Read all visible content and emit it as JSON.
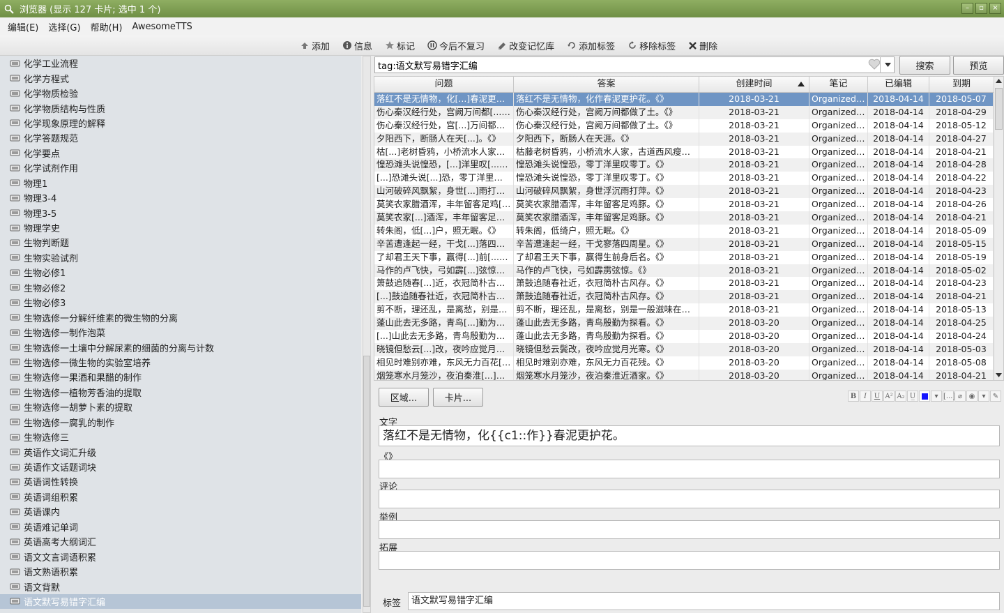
{
  "window": {
    "title": "浏览器 (显示 127 卡片; 选中 1 个)",
    "btn_min": "–",
    "btn_restore": "▫",
    "btn_close": "×"
  },
  "menu": [
    "编辑(E)",
    "选择(G)",
    "帮助(H)",
    "AwesomeTTS"
  ],
  "toolbar": {
    "add": "添加",
    "info": "信息",
    "mark": "标记",
    "suspend": "今后不复习",
    "change_deck": "改变记忆库",
    "add_tags": "添加标签",
    "remove_tags": "移除标签",
    "delete": "删除"
  },
  "decks": [
    "化学工业流程",
    "化学方程式",
    "化学物质检验",
    "化学物质结构与性质",
    "化学现象原理的解释",
    "化学答题规范",
    "化学要点",
    "化学试剂作用",
    "物理1",
    "物理3-4",
    "物理3-5",
    "物理学史",
    "生物判断题",
    "生物实验试剂",
    "生物必修1",
    "生物必修2",
    "生物必修3",
    "生物选修一分解纤维素的微生物的分离",
    "生物选修一制作泡菜",
    "生物选修一土壤中分解尿素的细菌的分离与计数",
    "生物选修一微生物的实验室培养",
    "生物选修一果酒和果醋的制作",
    "生物选修一植物芳香油的提取",
    "生物选修一胡萝卜素的提取",
    "生物选修一腐乳的制作",
    "生物选修三",
    "英语作文词汇升级",
    "英语作文话题词块",
    "英语词性转换",
    "英语词组积累",
    "英语课内",
    "英语难记单词",
    "英语高考大纲词汇",
    "语文文言词语积累",
    "语文熟语积累",
    "语文背默",
    "语文默写易错字汇编"
  ],
  "selected_deck_index": 36,
  "search": {
    "value": "tag:语文默写易错字汇编"
  },
  "buttons": {
    "search": "搜索",
    "preview": "预览",
    "fields": "区域...",
    "cards": "卡片..."
  },
  "columns": [
    "问题",
    "答案",
    "创建时间",
    "笔记",
    "已编辑",
    "到期"
  ],
  "rows": [
    [
      "落红不是无情物，化[...]春泥更护花。《》",
      "落红不是无情物，化作春泥更护花。《》",
      "2018-03-21",
      "Organized ...",
      "2018-04-14",
      "2018-05-07"
    ],
    [
      "伤心秦汉经行处，宫阙万间都[...]了土。《》",
      "伤心秦汉经行处，宫阙万间都做了土。《》",
      "2018-03-21",
      "Organized ...",
      "2018-04-14",
      "2018-04-29"
    ],
    [
      "伤心秦汉经行处，宫[...]万间都做了土。《》",
      "伤心秦汉经行处，宫阙万间都做了土。《》",
      "2018-03-21",
      "Organized ...",
      "2018-04-14",
      "2018-05-12"
    ],
    [
      "夕阳西下，断肠人在天[...]。《》",
      "夕阳西下，断肠人在天涯。《》",
      "2018-03-21",
      "Organized ...",
      "2018-04-14",
      "2018-04-27"
    ],
    [
      "枯[...]老树昏鸦，小桥流水人家，古道西风瘦马。《》",
      "枯藤老树昏鸦，小桥流水人家，古道西风瘦马。《》",
      "2018-03-21",
      "Organized ...",
      "2018-04-14",
      "2018-04-21"
    ],
    [
      "惶恐滩头说惶恐，[...]洋里叹[...]。《》",
      "惶恐滩头说惶恐，零丁洋里叹零丁。《》",
      "2018-03-21",
      "Organized ...",
      "2018-04-14",
      "2018-04-28"
    ],
    [
      "[...]恐滩头说[...]恐，零丁洋里叹零丁。《》",
      "惶恐滩头说惶恐，零丁洋里叹零丁。《》",
      "2018-03-21",
      "Organized ...",
      "2018-04-14",
      "2018-04-22"
    ],
    [
      "山河破碎风飘絮，身世[...]雨打萍。《》",
      "山河破碎风飘絮，身世浮沉雨打萍。《》",
      "2018-03-21",
      "Organized ...",
      "2018-04-14",
      "2018-04-23"
    ],
    [
      "莫笑农家腊酒浑，丰年留客足鸡[...]。《》",
      "莫笑农家腊酒浑，丰年留客足鸡豚。《》",
      "2018-03-21",
      "Organized ...",
      "2018-04-14",
      "2018-04-26"
    ],
    [
      "莫笑农家[...]酒浑，丰年留客足鸡豚。《》",
      "莫笑农家腊酒浑，丰年留客足鸡豚。《》",
      "2018-03-21",
      "Organized ...",
      "2018-04-14",
      "2018-04-21"
    ],
    [
      "转朱阁，低[...]户，照无眠。《》",
      "转朱阁，低绮户，照无眠。《》",
      "2018-03-21",
      "Organized ...",
      "2018-04-14",
      "2018-05-09"
    ],
    [
      "辛苦遭逢起一经，干戈[...]落四周星。《》",
      "辛苦遭逢起一经，干戈寥落四周星。《》",
      "2018-03-21",
      "Organized ...",
      "2018-04-14",
      "2018-05-15"
    ],
    [
      "了却君王天下事，赢得[...]前[...]后名。《》",
      "了却君王天下事，赢得生前身后名。《》",
      "2018-03-21",
      "Organized ...",
      "2018-04-14",
      "2018-05-19"
    ],
    [
      "马作的卢飞快，弓如霹[...]弦惊。《》",
      "马作的卢飞快，弓如霹雳弦惊。《》",
      "2018-03-21",
      "Organized ...",
      "2018-04-14",
      "2018-05-02"
    ],
    [
      "箫鼓追随春[...]近，衣冠简朴古风存。《》",
      "箫鼓追随春社近，衣冠简朴古风存。《》",
      "2018-03-21",
      "Organized ...",
      "2018-04-14",
      "2018-04-23"
    ],
    [
      "[...]鼓追随春社近，衣冠简朴古风存。《》",
      "箫鼓追随春社近，衣冠简朴古风存。《》",
      "2018-03-21",
      "Organized ...",
      "2018-04-14",
      "2018-04-21"
    ],
    [
      "剪不断，理还乱，是离愁，别是一[...]滋味在心头。《》",
      "剪不断，理还乱，是离愁，别是一般滋味在心头。《》",
      "2018-03-21",
      "Organized ...",
      "2018-04-14",
      "2018-05-13"
    ],
    [
      "蓬山此去无多路，青鸟[...]勤为探看。《》",
      "蓬山此去无多路，青鸟殷勤为探看。《》",
      "2018-03-20",
      "Organized ...",
      "2018-04-14",
      "2018-04-25"
    ],
    [
      "[...]山此去无多路，青鸟殷勤为探看。《》",
      "蓬山此去无多路，青鸟殷勤为探看。《》",
      "2018-03-20",
      "Organized ...",
      "2018-04-14",
      "2018-04-24"
    ],
    [
      "晓镜但愁云[...]改，夜吟应觉月光寒。《》",
      "晓镜但愁云鬓改，夜吟应觉月光寒。《》",
      "2018-03-20",
      "Organized ...",
      "2018-04-14",
      "2018-05-03"
    ],
    [
      "相见时难别亦难，东风无力百花[...]。《》",
      "相见时难别亦难，东风无力百花残。《》",
      "2018-03-20",
      "Organized ...",
      "2018-04-14",
      "2018-05-08"
    ],
    [
      "烟笼寒水月笼沙，夜泊秦淮[...]酒家。《》",
      "烟笼寒水月笼沙，夜泊秦淮近酒家。《》",
      "2018-03-20",
      "Organized ...",
      "2018-04-14",
      "2018-04-21"
    ]
  ],
  "editor": {
    "field_labels": [
      "文字",
      "《》",
      "评论",
      "举例",
      "拓展"
    ],
    "text_value": "落红不是无情物，化{{c1::作}}春泥更护花。",
    "tags_label": "标签",
    "tags_value": "语文默写易错字汇编"
  },
  "colors": {
    "titlebar": "#7f9e52",
    "selection": "#6f95c4",
    "sidebar": "#dfe3e7"
  }
}
